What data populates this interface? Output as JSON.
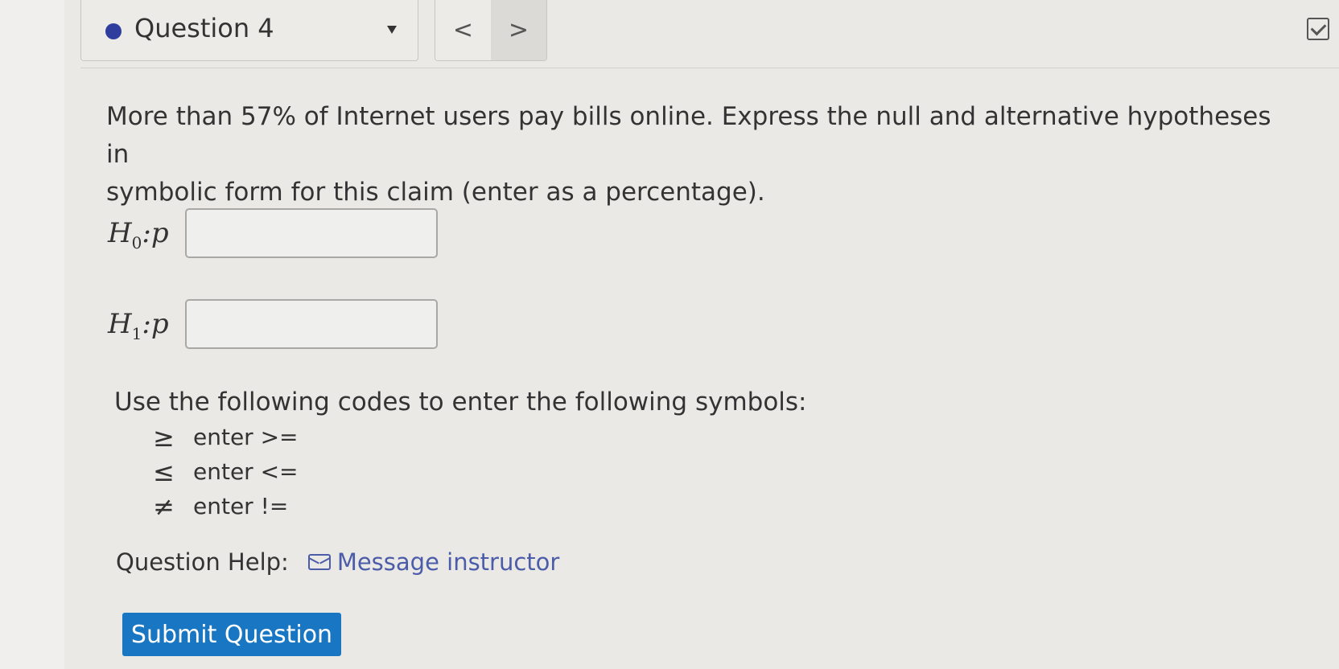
{
  "header": {
    "question_label": "Question 4",
    "prev_label": "<",
    "next_label": ">"
  },
  "question": {
    "prompt_line_1": "More than 57% of Internet users pay bills online. Express the null and alternative hypotheses in",
    "prompt_line_2": "symbolic form for this claim (enter as a percentage).",
    "h0_label_base": "H",
    "h0_label_sub": "0",
    "h0_label_rest": ":p",
    "h1_label_base": "H",
    "h1_label_sub": "1",
    "h1_label_rest": ":p",
    "h0_value": "",
    "h1_value": ""
  },
  "codes": {
    "title": "Use the following codes to enter the following symbols:",
    "items": [
      {
        "symbol": "≥",
        "text": "enter >="
      },
      {
        "symbol": "≤",
        "text": "enter <="
      },
      {
        "symbol": "≠",
        "text": "enter !="
      }
    ]
  },
  "help": {
    "label": "Question Help:",
    "link_label": "Message instructor"
  },
  "submit": {
    "label": "Submit Question"
  },
  "colors": {
    "status_dot": "#2f3e9e",
    "link": "#4b5ca8",
    "submit_bg": "#1876c2"
  }
}
